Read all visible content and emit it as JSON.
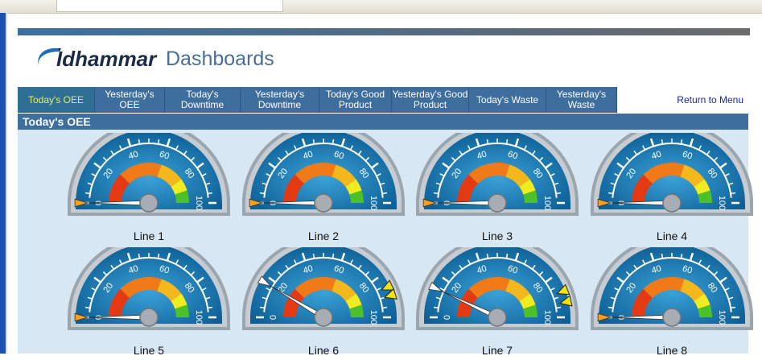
{
  "brand": {
    "logo_text": "Idhammar",
    "title": "Dashboards"
  },
  "nav": {
    "items": [
      {
        "label": "Today's OEE",
        "active": true
      },
      {
        "label": "Yesterday's OEE",
        "active": false
      },
      {
        "label": "Today's Downtime",
        "active": false
      },
      {
        "label": "Yesterday's Downtime",
        "active": false
      },
      {
        "label": "Today's Good Product",
        "active": false
      },
      {
        "label": "Yesterday's Good Product",
        "active": false
      },
      {
        "label": "Today's Waste",
        "active": false
      },
      {
        "label": "Yesterday's Waste",
        "active": false
      }
    ],
    "return_label": "Return to Menu"
  },
  "section": {
    "title": "Today's OEE"
  },
  "gauge_scale": {
    "ticks": [
      "0",
      "20",
      "40",
      "60",
      "80",
      "100"
    ]
  },
  "gauges": [
    {
      "label": "Line 1",
      "value": 0,
      "markers": []
    },
    {
      "label": "Line 2",
      "value": 0,
      "markers": []
    },
    {
      "label": "Line 3",
      "value": 0,
      "markers": []
    },
    {
      "label": "Line 4",
      "value": 0,
      "markers": []
    },
    {
      "label": "Line 5",
      "value": 0,
      "markers": []
    },
    {
      "label": "Line 6",
      "value": 17,
      "markers": [
        86,
        90
      ]
    },
    {
      "label": "Line 7",
      "value": 14,
      "markers": [
        88,
        93
      ]
    },
    {
      "label": "Line 8",
      "value": 0,
      "markers": []
    }
  ],
  "colors": {
    "nav": "#3d6e9e",
    "active_text": "#e0f060",
    "panel": "#d8e7f4",
    "gauge_body": "#1c7db6"
  }
}
